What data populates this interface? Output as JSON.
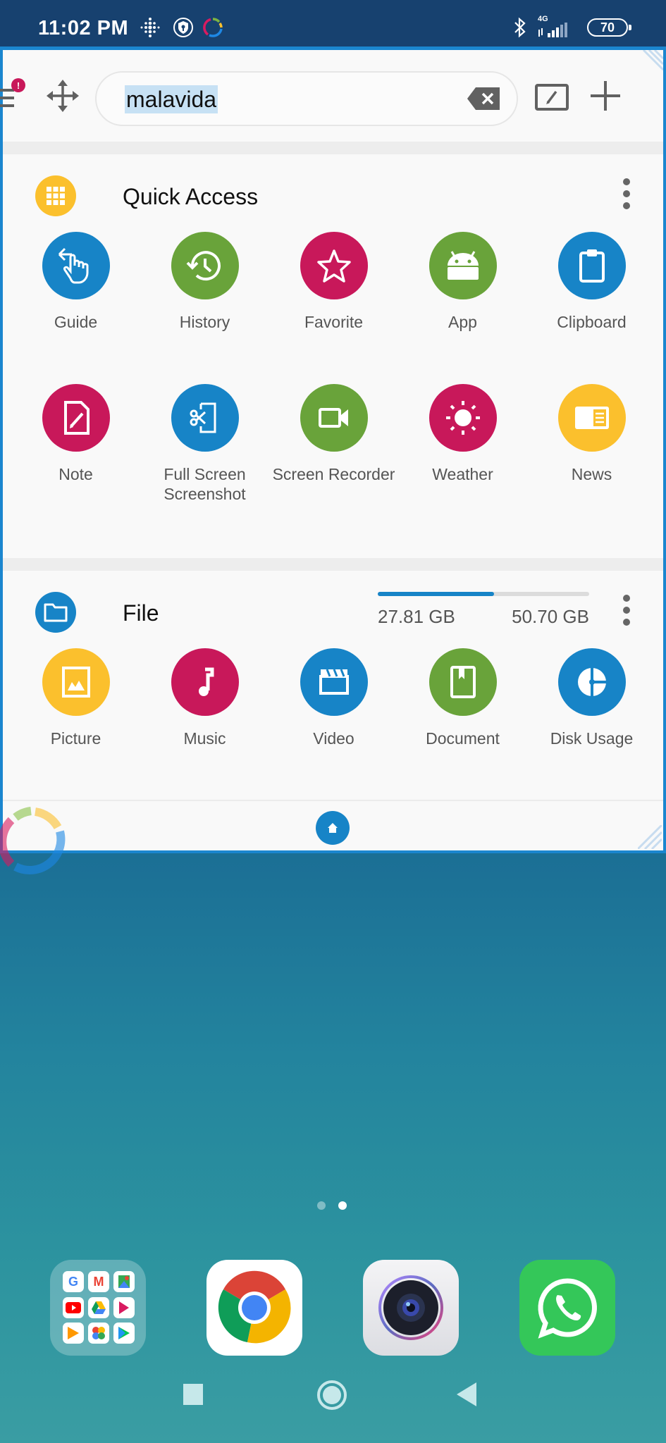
{
  "status_bar": {
    "time": "11:02 PM",
    "network": "4G",
    "battery": "70",
    "icons": [
      "fitbit-icon",
      "vpn-shield-icon",
      "sync-ring-icon",
      "bluetooth-icon",
      "signal-icon",
      "battery-icon"
    ]
  },
  "toolbar": {
    "notification_badge": "!",
    "search_value": "malavida",
    "icons": [
      "menu-icon",
      "move-icon",
      "clear-icon",
      "edit-icon",
      "plus-icon"
    ]
  },
  "quick_access": {
    "title": "Quick Access",
    "icon_color": "#fbc02d",
    "items": [
      {
        "label": "Guide",
        "icon": "guide-hand-icon",
        "color": "#1784c7"
      },
      {
        "label": "History",
        "icon": "history-icon",
        "color": "#69a33a"
      },
      {
        "label": "Favorite",
        "icon": "star-icon",
        "color": "#c8185a"
      },
      {
        "label": "App",
        "icon": "android-icon",
        "color": "#69a33a"
      },
      {
        "label": "Clipboard",
        "icon": "clipboard-icon",
        "color": "#1784c7"
      },
      {
        "label": "Note",
        "icon": "note-icon",
        "color": "#c8185a"
      },
      {
        "label": "Full Screen Screenshot",
        "icon": "screenshot-icon",
        "color": "#1784c7"
      },
      {
        "label": "Screen Recorder",
        "icon": "video-camera-icon",
        "color": "#69a33a"
      },
      {
        "label": "Weather",
        "icon": "sun-icon",
        "color": "#c8185a"
      },
      {
        "label": "News",
        "icon": "news-icon",
        "color": "#fbc02d"
      }
    ]
  },
  "file": {
    "title": "File",
    "icon_color": "#1784c7",
    "used": "27.81 GB",
    "total": "50.70 GB",
    "used_fraction": 0.549,
    "items": [
      {
        "label": "Picture",
        "icon": "picture-icon",
        "color": "#fbc02d"
      },
      {
        "label": "Music",
        "icon": "music-note-icon",
        "color": "#c8185a"
      },
      {
        "label": "Video",
        "icon": "clapperboard-icon",
        "color": "#1784c7"
      },
      {
        "label": "Document",
        "icon": "document-icon",
        "color": "#69a33a"
      },
      {
        "label": "Disk Usage",
        "icon": "disk-usage-icon",
        "color": "#1784c7"
      }
    ]
  },
  "home_screen": {
    "page_count": 2,
    "active_page": 2,
    "dock": [
      {
        "name": "google-folder",
        "apps": [
          "G",
          "M",
          "Maps",
          "YouTube",
          "Drive",
          "Play Movies",
          "Play Music",
          "Photos",
          "Play Store"
        ]
      },
      {
        "name": "chrome"
      },
      {
        "name": "camera"
      },
      {
        "name": "whatsapp"
      }
    ]
  },
  "nav": [
    "recents-button",
    "home-button",
    "back-button"
  ]
}
